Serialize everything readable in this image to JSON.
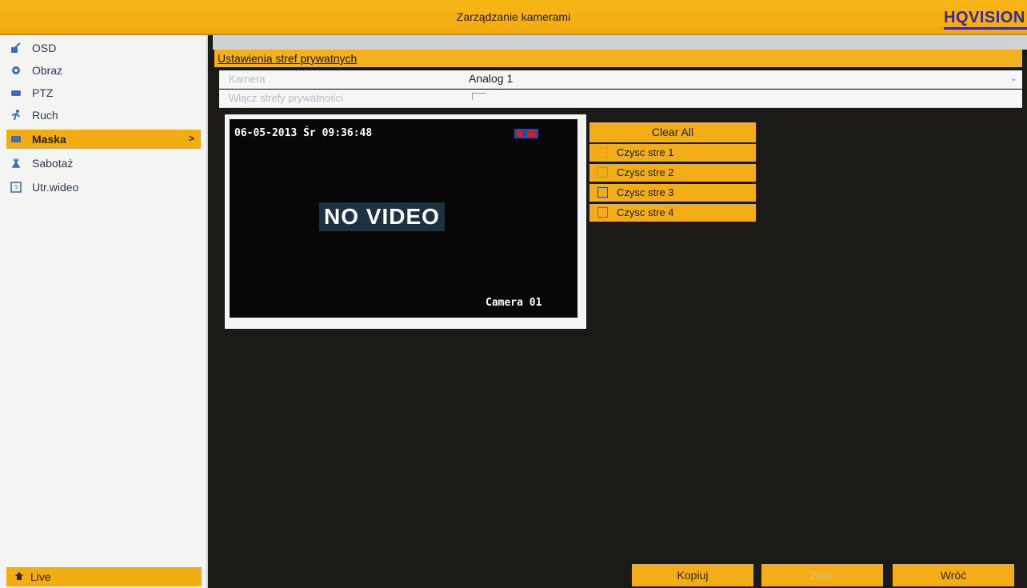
{
  "header": {
    "title": "Zarządzanie kamerami",
    "logo_text": "HQVISION"
  },
  "sidebar": {
    "items": [
      {
        "label": "OSD",
        "icon": "osd-icon"
      },
      {
        "label": "Obraz",
        "icon": "image-icon"
      },
      {
        "label": "PTZ",
        "icon": "ptz-icon"
      },
      {
        "label": "Ruch",
        "icon": "motion-icon"
      },
      {
        "label": "Maska",
        "icon": "mask-icon",
        "active": true
      },
      {
        "label": "Sabotaż",
        "icon": "tamper-icon"
      },
      {
        "label": "Utr.wideo",
        "icon": "video-loss-icon"
      }
    ],
    "live_label": "Live"
  },
  "main": {
    "section_title": "Ustawienia stref prywatnych",
    "camera_label": "Kamera",
    "camera_value": "Analog 1",
    "privacy_label": "Włącz strefy prywatności",
    "preview": {
      "timestamp": "06-05-2013 Śr 09:36:48",
      "no_video": "NO VIDEO",
      "camera_name": "Camera 01"
    },
    "clear_all": "Clear All",
    "areas": [
      {
        "label": "Czysc stre 1",
        "color": "#f3ad16"
      },
      {
        "label": "Czysc stre 2",
        "color": "#6bbd2c"
      },
      {
        "label": "Czysc stre 3",
        "color": "#2a3f8c"
      },
      {
        "label": "Czysc stre 4",
        "color": "#b5551c"
      }
    ],
    "buttons": {
      "copy": "Kopiuj",
      "apply": "Zast.",
      "back": "Wróć"
    }
  }
}
